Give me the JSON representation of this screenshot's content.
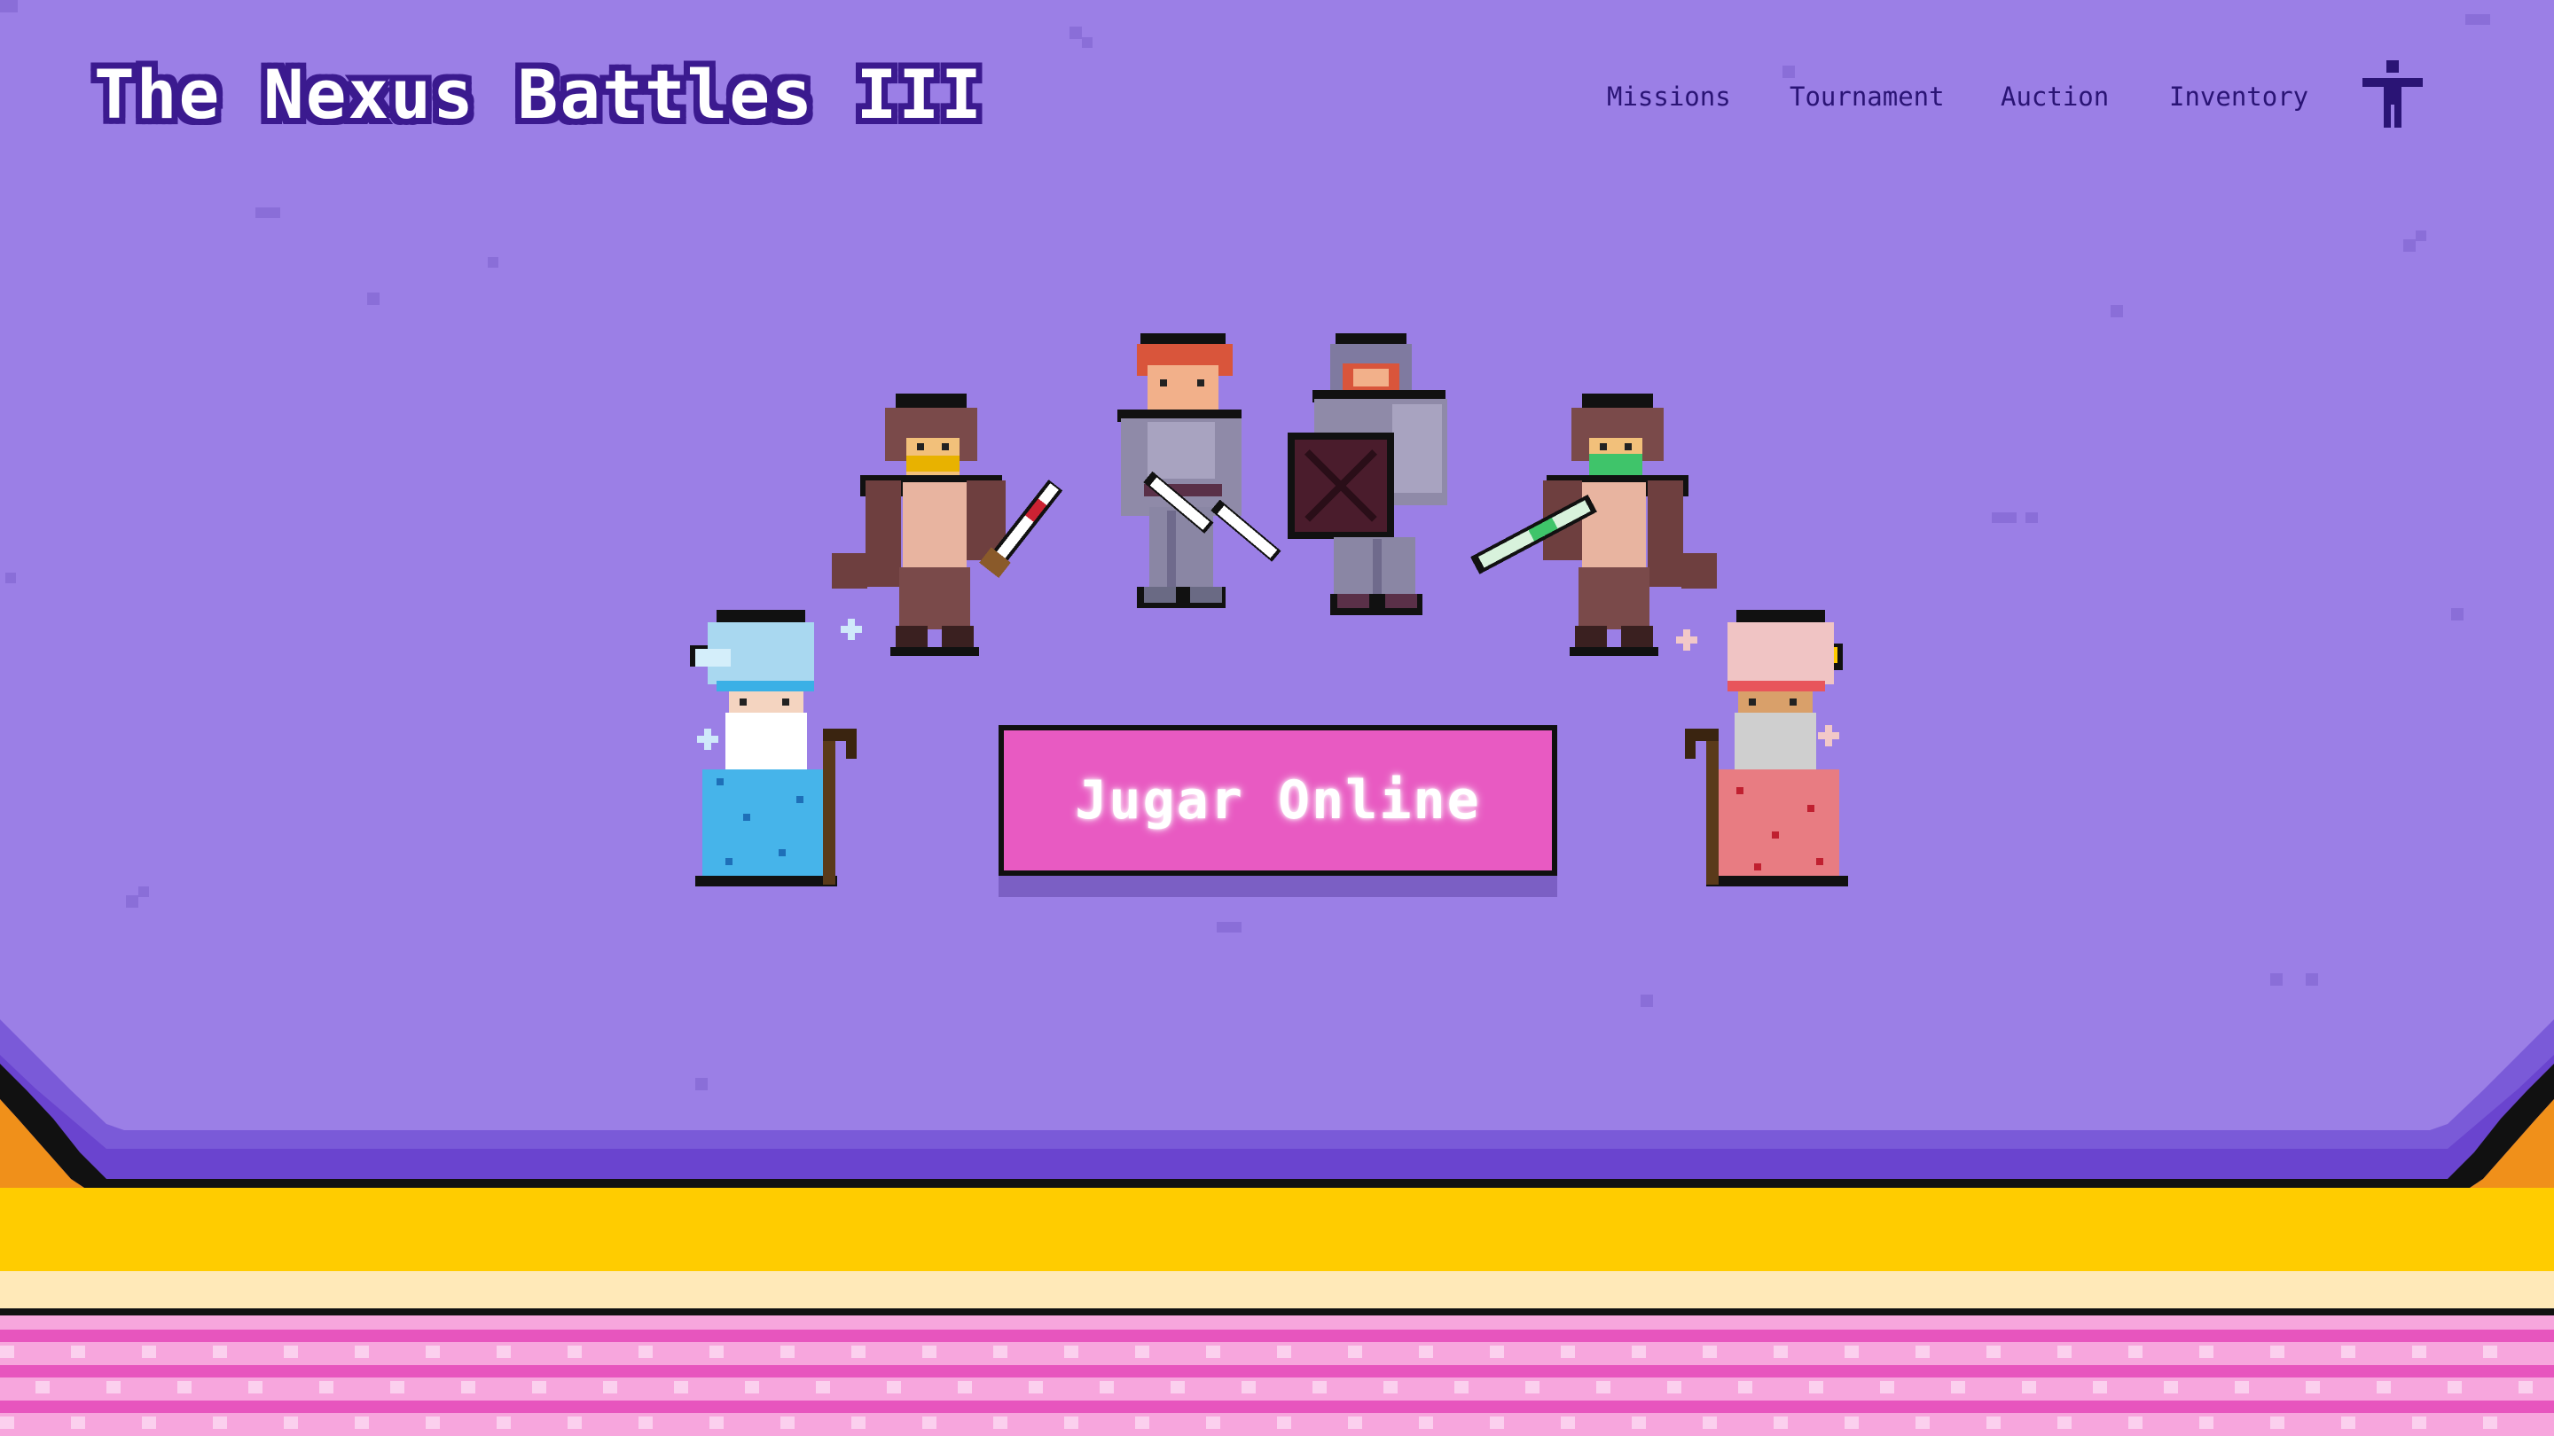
{
  "header": {
    "title": "The Nexus Battles III",
    "nav": [
      {
        "label": "Missions"
      },
      {
        "label": "Tournament"
      },
      {
        "label": "Auction"
      },
      {
        "label": "Inventory"
      }
    ],
    "accessibility_icon": "accessibility-icon"
  },
  "hero": {
    "play_button_label": "Jugar Online",
    "characters": [
      "rogue-left",
      "knight-swordswoman",
      "armored-warrior",
      "rogue-right",
      "ice-wizard",
      "fire-wizard"
    ]
  },
  "colors": {
    "background": "#9b7fe6",
    "title_outline": "#3b1a8f",
    "button": "#e85ac2",
    "stage_gold": "#ffcc00",
    "stage_cream": "#ffe9b8",
    "floor_pink": "#f06ec8"
  }
}
